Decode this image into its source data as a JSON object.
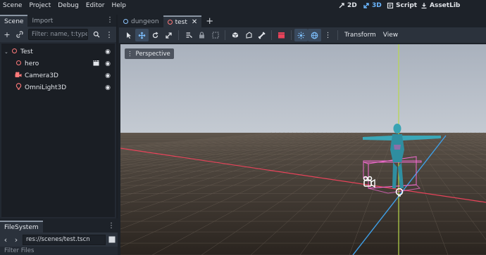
{
  "menu": [
    "Scene",
    "Project",
    "Debug",
    "Editor",
    "Help"
  ],
  "workspaces": [
    {
      "label": "2D",
      "icon": "2d-icon"
    },
    {
      "label": "3D",
      "icon": "3d-icon"
    },
    {
      "label": "Script",
      "icon": "script-icon"
    },
    {
      "label": "AssetLib",
      "icon": "assetlib-icon"
    }
  ],
  "scene_dock": {
    "tabs": [
      "Scene",
      "Import"
    ],
    "filter_placeholder": "Filter: name, t:type,",
    "tree": [
      {
        "label": "Test",
        "icon": "node3d-icon"
      },
      {
        "label": "hero",
        "icon": "node3d-icon"
      },
      {
        "label": "Camera3D",
        "icon": "camera-icon"
      },
      {
        "label": "OmniLight3D",
        "icon": "light-icon"
      }
    ]
  },
  "filesystem_dock": {
    "tab": "FileSystem",
    "path": "res://scenes/test.tscn",
    "filter_placeholder": "Filter Files"
  },
  "editor_tabs": [
    {
      "label": "dungeon",
      "active": false
    },
    {
      "label": "test",
      "active": true
    }
  ],
  "viewport_toolbar": {
    "transform_label": "Transform",
    "view_label": "View"
  },
  "viewport": {
    "perspective_label": "Perspective"
  },
  "colors": {
    "accent": "#6bb7ff",
    "x_axis": "#e8435a",
    "y_axis": "#b8d84a",
    "z_axis": "#3fa0e8",
    "selection": "#ff6edc"
  }
}
